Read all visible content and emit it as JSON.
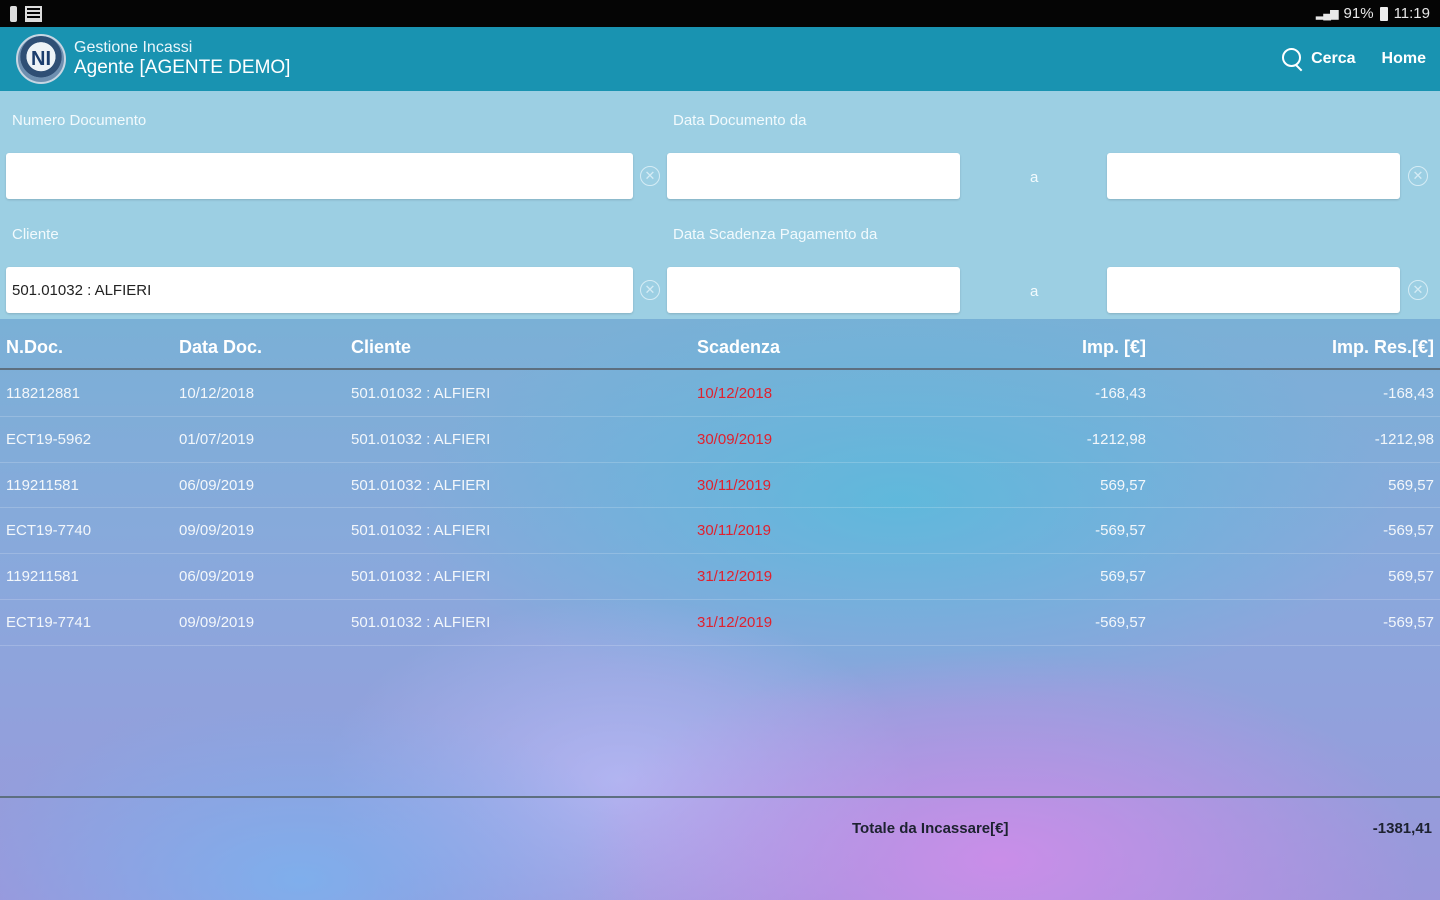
{
  "status_bar": {
    "battery": "91%",
    "time": "11:19"
  },
  "appbar": {
    "logo_text": "NI",
    "title": "Gestione Incassi",
    "subtitle": "Agente [AGENTE DEMO]",
    "search_label": "Cerca",
    "home_label": "Home"
  },
  "filters": {
    "doc_number_label": "Numero Documento",
    "doc_number_value": "",
    "doc_date_label": "Data Documento da",
    "doc_date_from": "",
    "doc_date_to": "",
    "client_label": "Cliente",
    "client_value": "501.01032 : ALFIERI",
    "due_date_label": "Data Scadenza Pagamento da",
    "due_date_from": "",
    "due_date_to": "",
    "to_separator": "a"
  },
  "table": {
    "headers": {
      "ndoc": "N.Doc.",
      "data_doc": "Data Doc.",
      "cliente": "Cliente",
      "scadenza": "Scadenza",
      "imp": "Imp. [€]",
      "imp_res": "Imp. Res.[€]"
    },
    "rows": [
      {
        "ndoc": "118212881",
        "data_doc": "10/12/2018",
        "cliente": "501.01032 : ALFIERI",
        "scadenza": "10/12/2018",
        "imp": "-168,43",
        "imp_res": "-168,43"
      },
      {
        "ndoc": "ECT19-5962",
        "data_doc": "01/07/2019",
        "cliente": "501.01032 : ALFIERI",
        "scadenza": "30/09/2019",
        "imp": "-1212,98",
        "imp_res": "-1212,98"
      },
      {
        "ndoc": "119211581",
        "data_doc": "06/09/2019",
        "cliente": "501.01032 : ALFIERI",
        "scadenza": "30/11/2019",
        "imp": "569,57",
        "imp_res": "569,57"
      },
      {
        "ndoc": "ECT19-7740",
        "data_doc": "09/09/2019",
        "cliente": "501.01032 : ALFIERI",
        "scadenza": "30/11/2019",
        "imp": "-569,57",
        "imp_res": "-569,57"
      },
      {
        "ndoc": "119211581",
        "data_doc": "06/09/2019",
        "cliente": "501.01032 : ALFIERI",
        "scadenza": "31/12/2019",
        "imp": "569,57",
        "imp_res": "569,57"
      },
      {
        "ndoc": "ECT19-7741",
        "data_doc": "09/09/2019",
        "cliente": "501.01032 : ALFIERI",
        "scadenza": "31/12/2019",
        "imp": "-569,57",
        "imp_res": "-569,57"
      }
    ]
  },
  "footer": {
    "total_label": "Totale da Incassare[€]",
    "total_value": "-1381,41"
  },
  "colors": {
    "appbar": "#1993b1",
    "filter_panel": "#9ccfe3",
    "due_date_red": "#e0212e"
  }
}
